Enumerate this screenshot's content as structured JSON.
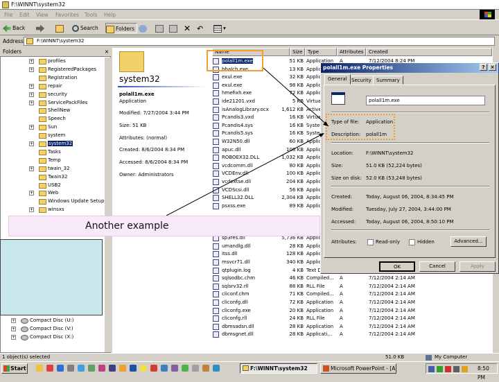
{
  "window": {
    "title": "F:\\WINNT\\system32"
  },
  "menu": [
    "File",
    "Edit",
    "View",
    "Favorites",
    "Tools",
    "Help"
  ],
  "toolbar": {
    "back": "Back",
    "search": "Search",
    "folders": "Folders"
  },
  "address": {
    "label": "Address",
    "value": "F:\\WINNT\\system32"
  },
  "folders": {
    "header": "Folders",
    "close": "×",
    "items": [
      {
        "label": "profiles",
        "plus": "+"
      },
      {
        "label": "RegisteredPackages",
        "plus": "+"
      },
      {
        "label": "Registration",
        "plus": ""
      },
      {
        "label": "repair",
        "plus": "+"
      },
      {
        "label": "security",
        "plus": "+"
      },
      {
        "label": "ServicePackFiles",
        "plus": "+"
      },
      {
        "label": "ShellNew",
        "plus": ""
      },
      {
        "label": "Speech",
        "plus": ""
      },
      {
        "label": "Sun",
        "plus": "+"
      },
      {
        "label": "system",
        "plus": ""
      },
      {
        "label": "system32",
        "plus": "+",
        "selected": true
      },
      {
        "label": "Tasks",
        "plus": ""
      },
      {
        "label": "Temp",
        "plus": ""
      },
      {
        "label": "twain_32",
        "plus": "+"
      },
      {
        "label": "Twain32",
        "plus": ""
      },
      {
        "label": "USB2",
        "plus": ""
      },
      {
        "label": "Web",
        "plus": "+"
      },
      {
        "label": "Windows Update Setup",
        "plus": ""
      },
      {
        "label": "winsxs",
        "plus": "+"
      }
    ],
    "drives": [
      "Compact Disc (U:)",
      "Compact Disc (V:)",
      "Compact Disc (X:)"
    ]
  },
  "info": {
    "folder": "system32",
    "file": "polall1m.exe",
    "type": "Application",
    "modified": "Modified: 7/27/2004 3:44 PM",
    "size": "Size: 51 KB",
    "attributes": "Attributes: (normal)",
    "created": "Created: 8/6/2004 8:34 PM",
    "accessed": "Accessed: 8/6/2004 8:34 PM",
    "owner": "Owner: Administrators"
  },
  "columns": [
    "Name",
    "Size",
    "Type",
    "Attributes",
    "Created"
  ],
  "files": [
    [
      "polall1m.exe",
      "51 KB",
      "Application",
      "A",
      "7/12/2004 8:24 PM"
    ],
    [
      "hbalch.exe",
      "13 KB",
      "Application",
      "",
      ""
    ],
    [
      "exul.exe",
      "32 KB",
      "Application",
      "",
      ""
    ],
    [
      "exul.exe",
      "98 KB",
      "Application",
      "",
      ""
    ],
    [
      "hmefixh.exe",
      "72 KB",
      "Application",
      "",
      ""
    ],
    [
      "ide21201.vxd",
      "5 KB",
      "Virtual",
      "",
      ""
    ],
    [
      "isAnalogLibrary.ocx",
      "1,612 KB",
      "ActiveX",
      "",
      ""
    ],
    [
      "Pcandis3.vxd",
      "16 KB",
      "Virtual",
      "",
      ""
    ],
    [
      "Pcandis4.sys",
      "16 KB",
      "System",
      "",
      ""
    ],
    [
      "Pcandis5.sys",
      "16 KB",
      "System",
      "",
      ""
    ],
    [
      "W32N50.dll",
      "60 KB",
      "Applica",
      "",
      ""
    ],
    [
      "apuc.dll",
      "108 KB",
      "Applica",
      "",
      ""
    ],
    [
      "ROBOEX32.DLL",
      "1,032 KB",
      "Applica",
      "",
      ""
    ],
    [
      "vcdcomm.dll",
      "80 KB",
      "Applica",
      "",
      ""
    ],
    [
      "VCDEnv.dll",
      "100 KB",
      "Applica",
      "",
      ""
    ],
    [
      "vcdextse.dll",
      "204 KB",
      "Applica",
      "",
      ""
    ],
    [
      "VCDScsi.dll",
      "56 KB",
      "Applica",
      "",
      ""
    ],
    [
      "SHELL32.DLL",
      "2,304 KB",
      "Applica",
      "",
      ""
    ],
    [
      "psxss.exe",
      "89 KB",
      "Applica",
      "",
      ""
    ],
    [
      "",
      "",
      "",
      "",
      ""
    ],
    [
      "",
      "",
      "",
      "",
      ""
    ],
    [
      "NETAPI32.DLL",
      "302 KB",
      "Applica",
      "",
      ""
    ],
    [
      "sp3res.dll",
      "5,736 KB",
      "Applica",
      "",
      ""
    ],
    [
      "umandlg.dll",
      "28 KB",
      "Applica",
      "",
      ""
    ],
    [
      "itss.dll",
      "128 KB",
      "Applica",
      "",
      ""
    ],
    [
      "msvcr71.dll",
      "340 KB",
      "Applica",
      "",
      ""
    ],
    [
      "qtplugin.log",
      "4 KB",
      "Text Doc",
      "A",
      "7/12/2004 2:14 AM"
    ],
    [
      "sqlsodbc.chm",
      "46 KB",
      "Compiled...",
      "A",
      "7/12/2004 2:14 AM"
    ],
    [
      "sqlsrv32.rll",
      "88 KB",
      "RLL File",
      "A",
      "7/12/2004 2:14 AM"
    ],
    [
      "cliconf.chm",
      "71 KB",
      "Compiled...",
      "A",
      "7/12/2004 2:14 AM"
    ],
    [
      "cliconfg.dll",
      "72 KB",
      "Application",
      "A",
      "7/12/2004 2:14 AM"
    ],
    [
      "cliconfg.exe",
      "20 KB",
      "Application",
      "A",
      "7/12/2004 2:14 AM"
    ],
    [
      "cliconfg.rll",
      "24 KB",
      "RLL File",
      "A",
      "7/12/2004 2:14 AM"
    ],
    [
      "dbmsadsn.dll",
      "28 KB",
      "Application",
      "A",
      "7/12/2004 2:14 AM"
    ],
    [
      "dbmsgnet.dll",
      "28 KB",
      "Applicati...",
      "A",
      "7/12/2004 2:14 AM"
    ]
  ],
  "dialog": {
    "title": "polall1m.exe Properties",
    "help": "?",
    "close": "×",
    "tabs": [
      "General",
      "Security",
      "Summary"
    ],
    "filename": "polall1m.exe",
    "type_label": "Type of file:",
    "type_value": "Application",
    "desc_label": "Description:",
    "desc_value": "polall1m",
    "loc_label": "Location:",
    "loc_value": "F:\\WINNT\\system32",
    "size_label": "Size:",
    "size_value": "51.0 KB (52,224 bytes)",
    "sod_label": "Size on disk:",
    "sod_value": "52.0 KB (53,248 bytes)",
    "created_label": "Created:",
    "created_value": "Today, August 06, 2004, 8:34:45 PM",
    "modified_label": "Modified:",
    "modified_value": "Tuesday, July 27, 2004, 3:44:00 PM",
    "accessed_label": "Accessed:",
    "accessed_value": "Today, August 06, 2004, 8:50:10 PM",
    "attr_label": "Attributes:",
    "readonly": "Read-only",
    "hidden": "Hidden",
    "advanced": "Advanced...",
    "ok": "OK",
    "cancel": "Cancel",
    "apply": "Apply"
  },
  "annotation": "Another example",
  "status": {
    "left": "1 object(s) selected",
    "size": "51.0 KB",
    "zone": "My Computer"
  },
  "taskbar": {
    "start": "Start",
    "task1": "F:\\WINNT\\system32",
    "task2": "Microsoft PowerPoint - [A...",
    "time": "8:50 PM"
  }
}
